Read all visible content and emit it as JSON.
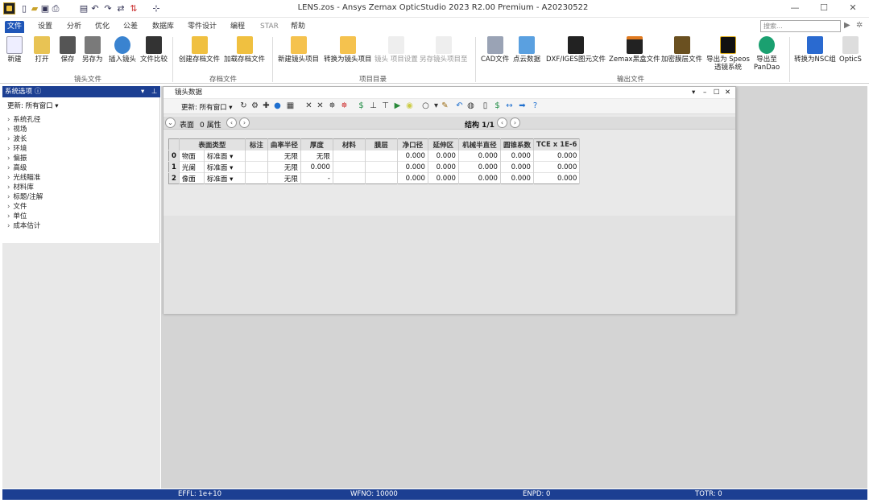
{
  "window": {
    "title": "LENS.zos - Ansys Zemax OpticStudio 2023 R2.00   Premium - A20230522"
  },
  "menu": [
    "文件",
    "设置",
    "分析",
    "优化",
    "公差",
    "数据库",
    "零件设计",
    "编程",
    "STAR",
    "帮助"
  ],
  "search": {
    "placeholder": "搜索..."
  },
  "ribbon": {
    "buttons": [
      "新建",
      "打开",
      "保存",
      "另存为",
      "插入镜头",
      "文件比较",
      "创建存档文件",
      "加载存档文件",
      "新建镜头项目",
      "转换为镜头项目",
      "镜头 项目设置",
      "另存镜头项目至",
      "CAD文件",
      "点云数据",
      "DXF/IGES图元文件",
      "Zemax黑盒文件",
      "加密膜层文件",
      "导出为 Speos 透镜系统",
      "导出至 PanDao",
      "转换为NSC组",
      "OpticS"
    ],
    "groups": [
      "镜头文件",
      "存档文件",
      "项目目录",
      "输出文件"
    ]
  },
  "left_panel": {
    "title": "系统选项",
    "config": "更新: 所有窗口 ▾",
    "items": [
      "系统孔径",
      "视场",
      "波长",
      "环境",
      "偏振",
      "高级",
      "光线瞄准",
      "材料库",
      "标题/注解",
      "文件",
      "单位",
      "成本估计"
    ]
  },
  "lde": {
    "title": "镜头数据",
    "update": "更新: 所有窗口 ▾",
    "surface_label": "表面",
    "surface_props": "0 属性",
    "config": "结构 1/1",
    "columns": [
      "",
      "表面类型",
      "标注",
      "曲率半径",
      "厚度",
      "材料",
      "膜层",
      "净口径",
      "延伸区",
      "机械半直径",
      "圆锥系数",
      "TCE x 1E-6"
    ],
    "rows": [
      {
        "n": "0",
        "name": "物面",
        "type": "标准面 ▾",
        "comment": "",
        "radius": "无限",
        "thickness": "无限",
        "material": "",
        "coating": "",
        "clear": "0.000",
        "chip": "0.000",
        "mech": "0.000",
        "conic": "0.000",
        "tce": "0.000"
      },
      {
        "n": "1",
        "name": "光阑",
        "type": "标准面 ▾",
        "comment": "",
        "radius": "无限",
        "thickness": "0.000",
        "material": "",
        "coating": "",
        "clear": "0.000",
        "chip": "0.000",
        "mech": "0.000",
        "conic": "0.000",
        "tce": "0.000"
      },
      {
        "n": "2",
        "name": "像面",
        "type": "标准面 ▾",
        "comment": "",
        "radius": "无限",
        "thickness": "-",
        "material": "",
        "coating": "",
        "clear": "0.000",
        "chip": "0.000",
        "mech": "0.000",
        "conic": "0.000",
        "tce": "0.000"
      }
    ]
  },
  "status": {
    "effl": "EFFL: 1e+10",
    "wfno": "WFNO: 10000",
    "enpd": "ENPD: 0",
    "totr": "TOTR: 0"
  }
}
